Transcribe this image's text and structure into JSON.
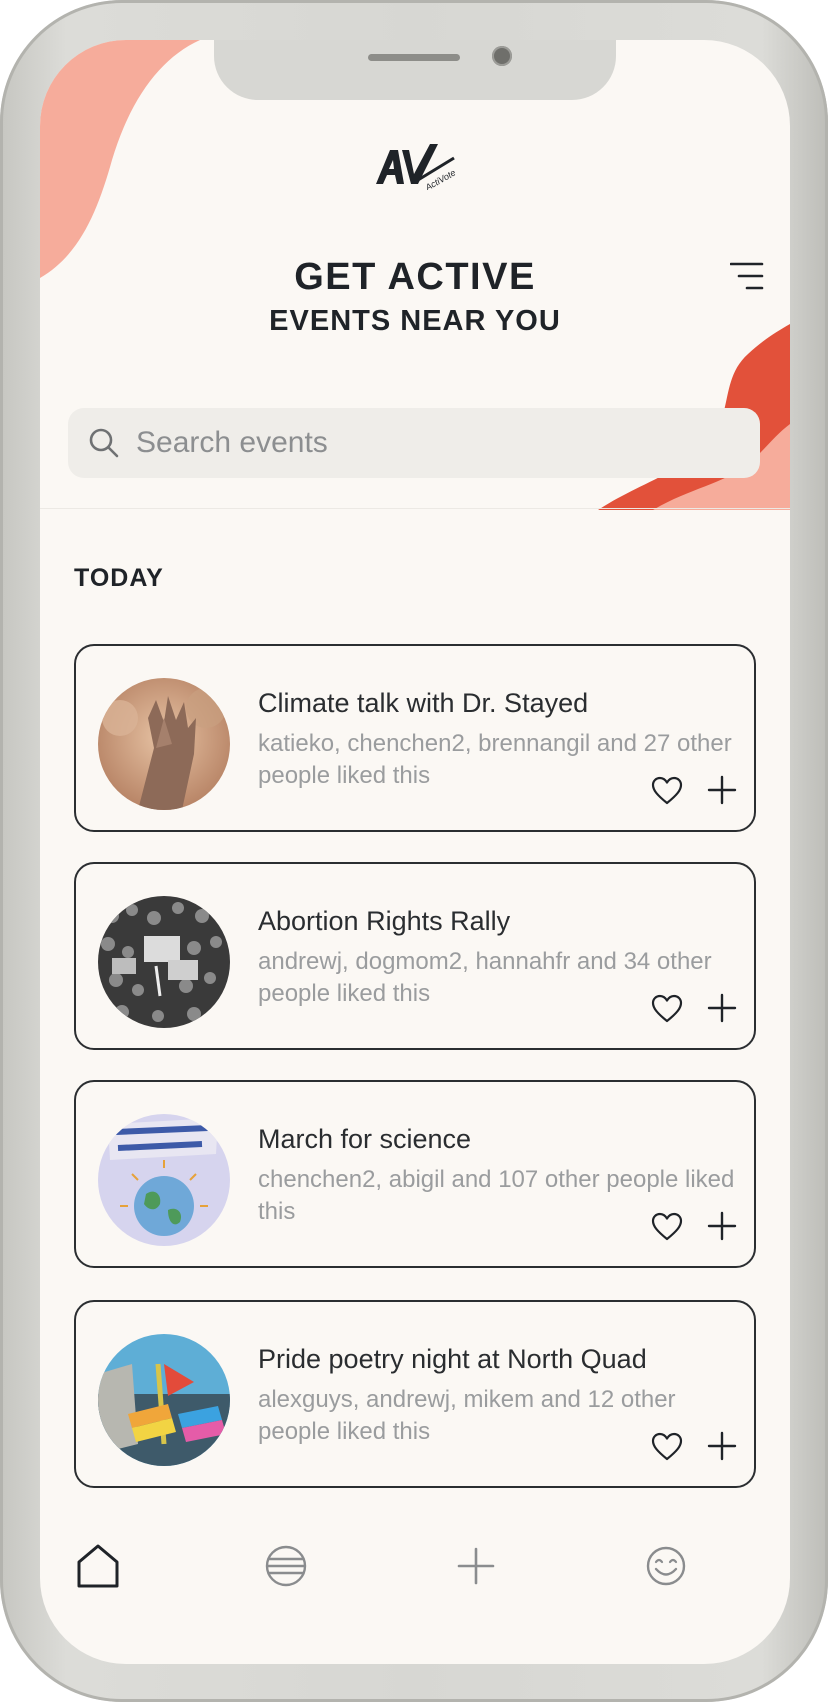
{
  "app": {
    "logo_text": "AV",
    "logo_sub": "ActiVote"
  },
  "header": {
    "title": "GET ACTIVE",
    "subtitle": "EVENTS NEAR YOU",
    "menu_icon": "menu-icon"
  },
  "search": {
    "placeholder": "Search events",
    "value": "",
    "icon": "search-icon"
  },
  "section": {
    "label": "TODAY"
  },
  "events": [
    {
      "title": "Climate talk with Dr. Stayed",
      "likes": "katieko, chenchen2, brennangil and 27 other people liked this"
    },
    {
      "title": "Abortion Rights Rally",
      "likes": "andrewj, dogmom2, hannahfr and 34 other people liked this"
    },
    {
      "title": "March for science",
      "likes": "chenchen2, abigil and 107 other people liked this"
    },
    {
      "title": "Pride poetry night at North Quad",
      "likes": "alexguys, andrewj, mikem and 12 other people liked this"
    }
  ],
  "tabbar": {
    "items": [
      "home-icon",
      "globe-icon",
      "add-icon",
      "smiley-icon"
    ]
  },
  "colors": {
    "background": "#fbf8f4",
    "accent_coral": "#f6ac9b",
    "accent_red": "#e2513a",
    "text_dark": "#1f2328",
    "text_muted": "#9a9c9e"
  }
}
